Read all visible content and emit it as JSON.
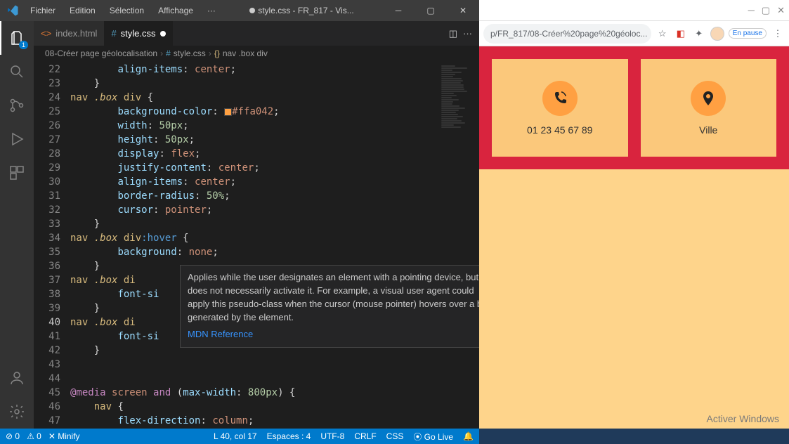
{
  "vscode": {
    "menus": [
      "Fichier",
      "Edition",
      "Sélection",
      "Affichage",
      "···"
    ],
    "windowTitle": "style.css - FR_817 - Vis...",
    "activity": {
      "badge": "1"
    },
    "tabs": [
      {
        "icon": "html-icon",
        "label": "index.html",
        "active": false,
        "modified": false
      },
      {
        "icon": "css-icon",
        "label": "style.css",
        "active": true,
        "modified": true
      }
    ],
    "breadcrumbs": {
      "folder": "08-Créer page géolocalisation",
      "file": "style.css",
      "selector": "nav .box div"
    },
    "lineStart": 22,
    "currentLine": 40,
    "code": [
      [
        [
          "        ",
          ""
        ],
        [
          "align-items",
          "prop"
        ],
        [
          ": ",
          "punc"
        ],
        [
          "center",
          "val"
        ],
        [
          ";",
          "punc"
        ]
      ],
      [
        [
          "    }",
          "punc"
        ]
      ],
      [
        [
          "nav ",
          "sel"
        ],
        [
          ".box",
          "class"
        ],
        [
          " div ",
          "sel"
        ],
        [
          "{",
          "punc"
        ]
      ],
      [
        [
          "        ",
          ""
        ],
        [
          "background-color",
          "prop"
        ],
        [
          ": ",
          "punc"
        ],
        [
          "SWATCH",
          ""
        ],
        [
          "#ffa042",
          "val"
        ],
        [
          ";",
          "punc"
        ]
      ],
      [
        [
          "        ",
          ""
        ],
        [
          "width",
          "prop"
        ],
        [
          ": ",
          "punc"
        ],
        [
          "50px",
          "num"
        ],
        [
          ";",
          "punc"
        ]
      ],
      [
        [
          "        ",
          ""
        ],
        [
          "height",
          "prop"
        ],
        [
          ": ",
          "punc"
        ],
        [
          "50px",
          "num"
        ],
        [
          ";",
          "punc"
        ]
      ],
      [
        [
          "        ",
          ""
        ],
        [
          "display",
          "prop"
        ],
        [
          ": ",
          "punc"
        ],
        [
          "flex",
          "val"
        ],
        [
          ";",
          "punc"
        ]
      ],
      [
        [
          "        ",
          ""
        ],
        [
          "justify-content",
          "prop"
        ],
        [
          ": ",
          "punc"
        ],
        [
          "center",
          "val"
        ],
        [
          ";",
          "punc"
        ]
      ],
      [
        [
          "        ",
          ""
        ],
        [
          "align-items",
          "prop"
        ],
        [
          ": ",
          "punc"
        ],
        [
          "center",
          "val"
        ],
        [
          ";",
          "punc"
        ]
      ],
      [
        [
          "        ",
          ""
        ],
        [
          "border-radius",
          "prop"
        ],
        [
          ": ",
          "punc"
        ],
        [
          "50%",
          "num"
        ],
        [
          ";",
          "punc"
        ]
      ],
      [
        [
          "        ",
          ""
        ],
        [
          "cursor",
          "prop"
        ],
        [
          ": ",
          "punc"
        ],
        [
          "pointer",
          "val"
        ],
        [
          ";",
          "punc"
        ]
      ],
      [
        [
          "    }",
          "punc"
        ]
      ],
      [
        [
          "nav ",
          "sel"
        ],
        [
          ".box",
          "class"
        ],
        [
          " div",
          "sel"
        ],
        [
          ":hover",
          "func"
        ],
        [
          " {",
          "punc"
        ]
      ],
      [
        [
          "        ",
          ""
        ],
        [
          "background",
          "prop"
        ],
        [
          ": ",
          "punc"
        ],
        [
          "none",
          "val"
        ],
        [
          ";",
          "punc"
        ]
      ],
      [
        [
          "    }",
          "punc"
        ]
      ],
      [
        [
          "nav ",
          "sel"
        ],
        [
          ".box",
          "class"
        ],
        [
          " di",
          "sel"
        ]
      ],
      [
        [
          "        ",
          ""
        ],
        [
          "font-si",
          "prop"
        ]
      ],
      [
        [
          "    }",
          "punc"
        ]
      ],
      [
        [
          "nav ",
          "sel"
        ],
        [
          ".box",
          "class"
        ],
        [
          " di",
          "sel"
        ]
      ],
      [
        [
          "        ",
          ""
        ],
        [
          "font-si",
          "prop"
        ]
      ],
      [
        [
          "    }",
          "punc"
        ]
      ],
      [
        [
          "",
          ""
        ]
      ],
      [
        [
          "",
          ""
        ]
      ],
      [
        [
          "@media",
          "kw"
        ],
        [
          " ",
          "punc"
        ],
        [
          "screen",
          "val"
        ],
        [
          " ",
          "punc"
        ],
        [
          "and",
          "kw"
        ],
        [
          " (",
          "punc"
        ],
        [
          "max-width",
          "prop"
        ],
        [
          ": ",
          "punc"
        ],
        [
          "800px",
          "num"
        ],
        [
          ") {",
          "punc"
        ]
      ],
      [
        [
          "    ",
          "punc"
        ],
        [
          "nav ",
          "sel"
        ],
        [
          "{",
          "punc"
        ]
      ],
      [
        [
          "        ",
          ""
        ],
        [
          "flex-direction",
          "prop"
        ],
        [
          ": ",
          "punc"
        ],
        [
          "column",
          "val"
        ],
        [
          ";",
          "punc"
        ]
      ]
    ],
    "hover": {
      "text": "Applies while the user designates an element with a pointing device, but does not necessarily activate it. For example, a visual user agent could apply this pseudo-class when the cursor (mouse pointer) hovers over a box generated by the element.",
      "link": "MDN Reference"
    },
    "statusbar": {
      "errors": "⊘ 0",
      "warnings": "⚠ 0",
      "minify": "✕  Minify",
      "cursor": "L 40, col 17",
      "spaces": "Espaces : 4",
      "encoding": "UTF-8",
      "eol": "CRLF",
      "lang": "CSS",
      "golive": "⦿ Go Live",
      "bell": "🔔"
    }
  },
  "browser": {
    "url": "p/FR_817/08-Créer%20page%20géoloc...",
    "pause": "En pause",
    "cards": [
      {
        "icon": "phone",
        "label": "01 23 45 67 89"
      },
      {
        "icon": "pin",
        "label": "Ville"
      }
    ],
    "watermark": "Activer Windows"
  }
}
